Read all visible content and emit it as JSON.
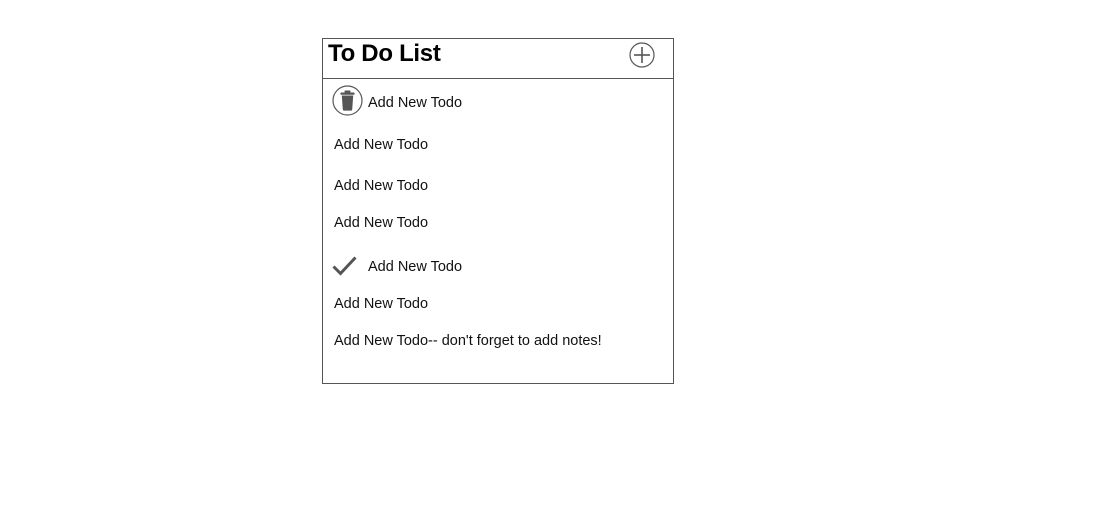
{
  "header": {
    "title": "To Do List",
    "add_icon": "plus-circle-icon"
  },
  "todos": [
    {
      "text": "Add New Todo",
      "icon": "trash-icon"
    },
    {
      "text": "Add New Todo",
      "icon": ""
    },
    {
      "text": "Add New Todo",
      "icon": ""
    },
    {
      "text": "Add New Todo",
      "icon": ""
    },
    {
      "text": "Add New Todo",
      "icon": "checkmark-icon"
    },
    {
      "text": "Add New Todo",
      "icon": ""
    },
    {
      "text": "Add New Todo-- don't forget to add notes!",
      "icon": ""
    }
  ],
  "colors": {
    "border": "#555555",
    "icon": "#555555"
  }
}
